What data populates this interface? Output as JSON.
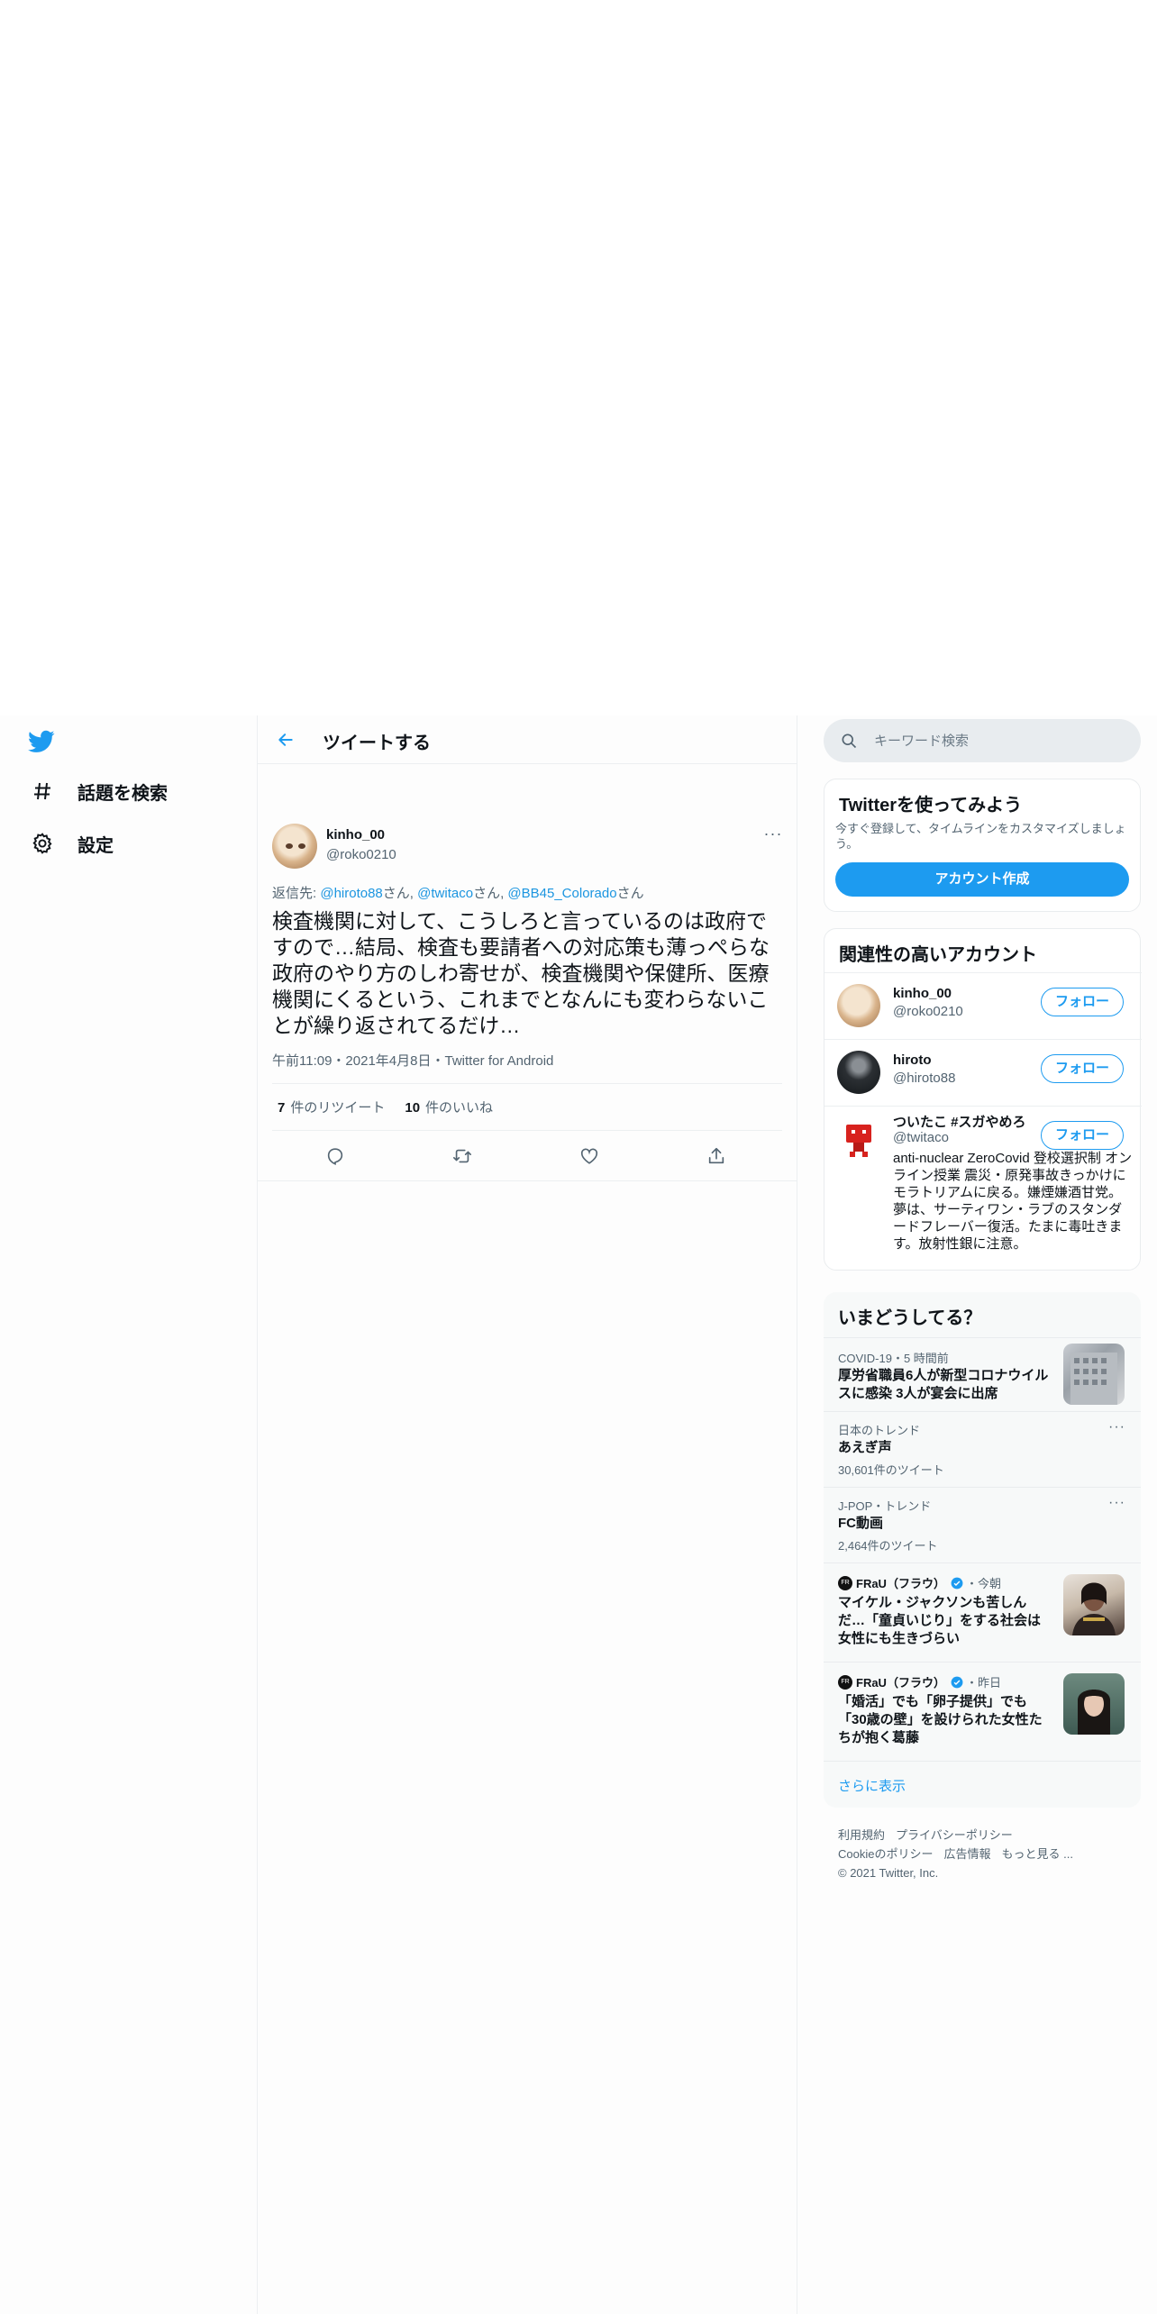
{
  "nav": {
    "items": [
      {
        "label": "話題を検索",
        "icon": "hashtag-icon"
      },
      {
        "label": "設定",
        "icon": "gear-icon"
      }
    ]
  },
  "header": {
    "title": "ツイートする"
  },
  "tweet": {
    "author_name": "kinho_00",
    "author_handle": "@roko0210",
    "reply_prefix": "返信先: ",
    "reply_mentions": [
      "@hiroto88",
      "@twitaco",
      "@BB45_Colorado"
    ],
    "reply_suffix": "さん",
    "reply_sep": ", ",
    "text": "検査機関に対して、こうしろと言っているのは政府ですので…結局、検査も要請者への対応策も薄っぺらな政府のやり方のしわ寄せが、検査機関や保健所、医療機関にくるという、これまでとなんにも変わらないことが繰り返されてるだけ…",
    "meta": "午前11:09・2021年4月8日・Twitter for Android",
    "retweets": "7",
    "retweets_label": "件のリツイート",
    "likes": "10",
    "likes_label": "件のいいね"
  },
  "search": {
    "placeholder": "キーワード検索"
  },
  "signup": {
    "title": "Twitterを使ってみよう",
    "subtitle": "今すぐ登録して、タイムラインをカスタマイズしましょう。",
    "button": "アカウント作成"
  },
  "related": {
    "title": "関連性の高いアカウント",
    "follow_label": "フォロー",
    "accounts": [
      {
        "name": "kinho_00",
        "handle": "@roko0210",
        "bio": ""
      },
      {
        "name": "hiroto",
        "handle": "@hiroto88",
        "bio": ""
      },
      {
        "name": "ついたこ #スガやめろ",
        "handle": "@twitaco",
        "bio": "anti-nuclear ZeroCovid 登校選択制 オンライン授業 震災・原発事故きっかけにモラトリアムに戻る。嫌煙嫌酒甘党。夢は、サーティワン・ラブのスタンダードフレーバー復活。たまに毒吐きます。放射性銀に注意。"
      }
    ]
  },
  "trends": {
    "title": "いまどうしてる？",
    "items": [
      {
        "meta": "COVID-19・5 時間前",
        "headline": "厚労省職員6人が新型コロナウイルスに感染 3人が宴会に出席"
      },
      {
        "meta": "日本のトレンド",
        "headline": "あえぎ声",
        "count": "30,601件のツイート"
      },
      {
        "meta": "J-POP・トレンド",
        "headline": "FC動画",
        "count": "2,464件のツイート"
      },
      {
        "publisher": "FRaU（フラウ）",
        "ago": "・今朝",
        "headline": "マイケル・ジャクソンも苦しんだ…「童貞いじり」をする社会は女性にも生きづらい"
      },
      {
        "publisher": "FRaU（フラウ）",
        "ago": "・昨日",
        "headline": "「婚活」でも「卵子提供」でも「30歳の壁」を設けられた女性たちが抱く葛藤"
      }
    ],
    "show_more": "さらに表示"
  },
  "footer": {
    "links_row1": [
      "利用規約",
      "プライバシーポリシー"
    ],
    "links_row2": [
      "Cookieのポリシー",
      "広告情報",
      "もっと見る ..."
    ],
    "copyright": "© 2021 Twitter, Inc."
  },
  "colors": {
    "accent": "#1d9bf0",
    "text": "#0f1419",
    "secondary": "#536471"
  }
}
